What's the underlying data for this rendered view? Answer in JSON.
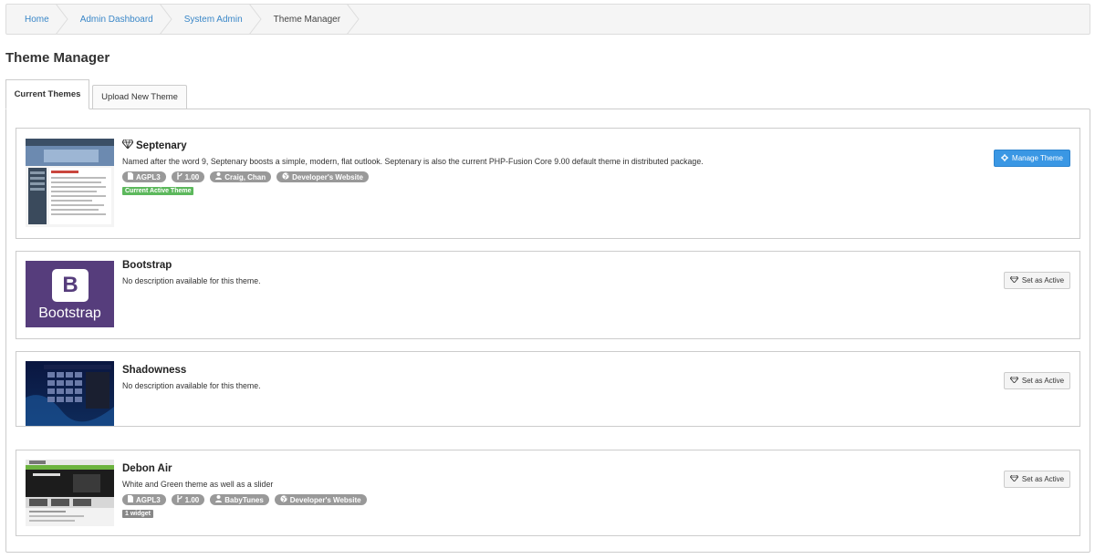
{
  "breadcrumb": [
    {
      "label": "Home",
      "active": false
    },
    {
      "label": "Admin Dashboard",
      "active": false
    },
    {
      "label": "System Admin",
      "active": false
    },
    {
      "label": "Theme Manager",
      "active": true
    }
  ],
  "page": {
    "title": "Theme Manager"
  },
  "tabs": [
    {
      "label": "Current Themes",
      "active": true
    },
    {
      "label": "Upload New Theme",
      "active": false
    }
  ],
  "themes": [
    {
      "name": "Septenary",
      "icon": "diamond-icon",
      "description": "Named after the word 9, Septenary boosts a simple, modern, flat outlook. Septenary is also the current PHP-Fusion Core 9.00 default theme in distributed package.",
      "license": "AGPL3",
      "version": "1.00",
      "author": "Craig, Chan",
      "website_label": "Developer's Website",
      "status_tag": "Current Active Theme",
      "button": "Manage Theme"
    },
    {
      "name": "Bootstrap",
      "description": "No description available for this theme.",
      "thumb_letter": "B",
      "thumb_text": "Bootstrap",
      "button": "Set as Active"
    },
    {
      "name": "Shadowness",
      "description": "No description available for this theme.",
      "button": "Set as Active"
    },
    {
      "name": "Debon Air",
      "description": "White and Green theme as well as a slider",
      "license": "AGPL3",
      "version": "1.00",
      "author": "BabyTunes",
      "website_label": "Developer's Website",
      "widget_tag": "1 widget",
      "button": "Set as Active"
    }
  ],
  "colors": {
    "link": "#3a87c8",
    "primary": "#3a97e4",
    "success": "#5cb85c",
    "badge": "#999999",
    "bootstrap_purple": "#563d7c"
  }
}
